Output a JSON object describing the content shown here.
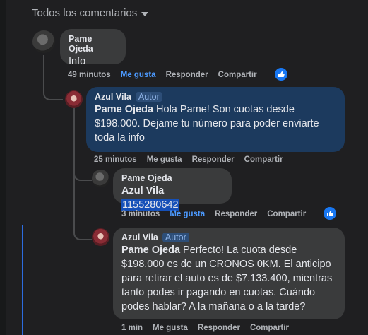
{
  "header": {
    "title": "Todos los comentarios"
  },
  "comments": [
    {
      "author": "Pame Ojeda",
      "text": "Info",
      "time": "49 minutos",
      "like": "Me gusta",
      "reply": "Responder",
      "share": "Compartir",
      "liked": true,
      "reaction": "like"
    },
    {
      "author": "Azul Vila",
      "badge": "Autor",
      "mention": "Pame Ojeda",
      "text_line1": "Hola Pame! Son cuotas desde",
      "text_line2": "$198.000. Dejame tu número para poder enviarte",
      "text_line3": "toda la info",
      "time": "25 minutos",
      "like": "Me gusta",
      "reply": "Responder",
      "share": "Compartir",
      "liked": false
    },
    {
      "author": "Pame Ojeda",
      "mention": "Azul Vila",
      "highlight": "1155280642",
      "time": "3 minutos",
      "like": "Me gusta",
      "reply": "Responder",
      "share": "Compartir",
      "liked": true,
      "reaction": "like"
    },
    {
      "author": "Azul Vila",
      "badge": "Autor",
      "mention": "Pame Ojeda",
      "text_line1": "Perfecto! La cuota desde",
      "text_line2": "$198.000 es de un CRONOS 0KM. El anticipo",
      "text_line3": "para retirar el auto es de $7.133.400, mientras",
      "text_line4": "tanto podes ir pagando en cuotas. Cuándo",
      "text_line5": "podes hablar? A la mañana o a la tarde?",
      "time": "1 min",
      "like": "Me gusta",
      "reply": "Responder",
      "share": "Compartir",
      "liked": false
    }
  ],
  "colors": {
    "background": "#1f1f21",
    "bubble": "#3a3b3c",
    "author_bubble": "#1c3a5e",
    "link_blue": "#4c9aff",
    "highlight": "#1550b8"
  },
  "icons": {
    "header_caret": "caret-down-icon",
    "reaction": "thumbs-up-icon"
  }
}
